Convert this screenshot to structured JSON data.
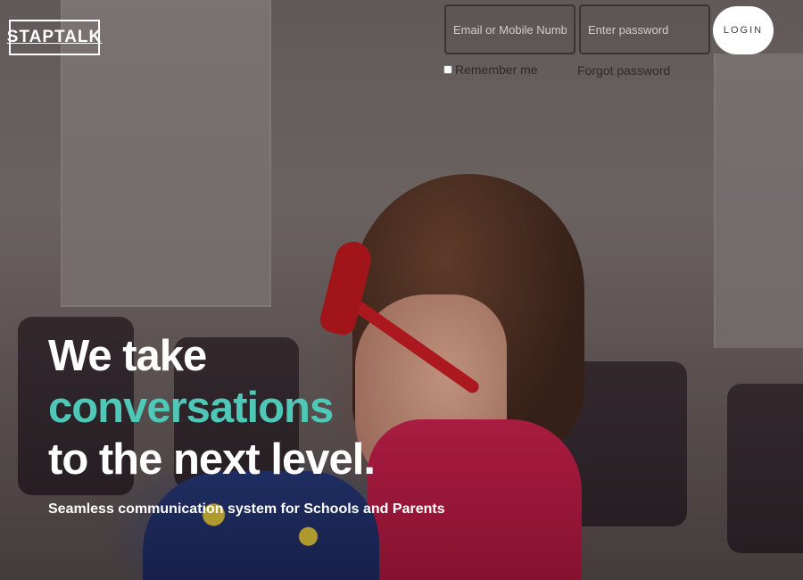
{
  "brand": {
    "logo_text": "STAPTALK"
  },
  "login_form": {
    "email_placeholder": "Email or Mobile Number",
    "password_placeholder": "Enter password",
    "login_label": "LOGIN",
    "remember_label": "Remember me",
    "remember_checked": false,
    "forgot_label": "Forgot password"
  },
  "hero": {
    "line1": "We take",
    "line2": "conversations",
    "line3": "to the next level.",
    "tagline": "Seamless communication system for Schools and Parents"
  },
  "colors": {
    "accent": "#4fc8b8",
    "text_light": "#ffffff",
    "login_bg": "#ffffff"
  }
}
